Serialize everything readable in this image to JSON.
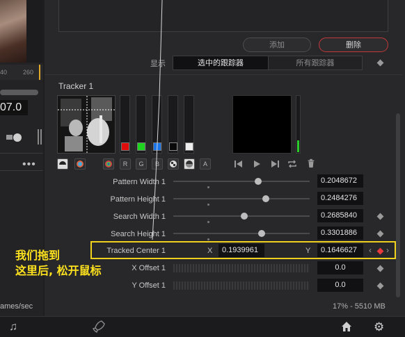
{
  "left_panel": {
    "ruler_ticks": [
      "40",
      "260"
    ],
    "value": "07.0",
    "more_label": "•••",
    "fps_label": "ames/sec"
  },
  "tracker_list": {
    "add_label": "添加",
    "delete_label": "删除",
    "display_label": "显示",
    "display_options": [
      "选中的跟踪器",
      "所有跟踪器"
    ],
    "display_selected": "选中的跟踪器"
  },
  "tracker": {
    "title": "Tracker 1",
    "channel_buttons": [
      "R",
      "G",
      "B",
      "A"
    ],
    "swatch_colors": [
      "#e00d0d",
      "#1ed41e",
      "#1c75e8",
      "#0a0a0a",
      "#eeeeee"
    ],
    "params": [
      {
        "label": "Pattern Width 1",
        "value": "0.2048672",
        "slider": 0.62
      },
      {
        "label": "Pattern Height 1",
        "value": "0.2484276",
        "slider": 0.68
      },
      {
        "label": "Search Width 1",
        "value": "0.2685840",
        "slider": 0.52
      },
      {
        "label": "Search Height 1",
        "value": "0.3301886",
        "slider": 0.65
      }
    ],
    "tracked_center": {
      "label": "Tracked Center 1",
      "x_label": "X",
      "x_value": "0.1939961",
      "y_label": "Y",
      "y_value": "0.1646627"
    },
    "offsets": [
      {
        "label": "X Offset 1",
        "value": "0.0"
      },
      {
        "label": "Y Offset 1",
        "value": "0.0"
      }
    ]
  },
  "annotation": {
    "line1": "我们拖到",
    "line2": "这里后, 松开鼠标"
  },
  "status": {
    "memory": "17% - 5510 MB"
  },
  "colors": {
    "highlight": "#f0d11b",
    "delete_border": "#c4383b",
    "keyframe_active": "#e83a3a"
  }
}
